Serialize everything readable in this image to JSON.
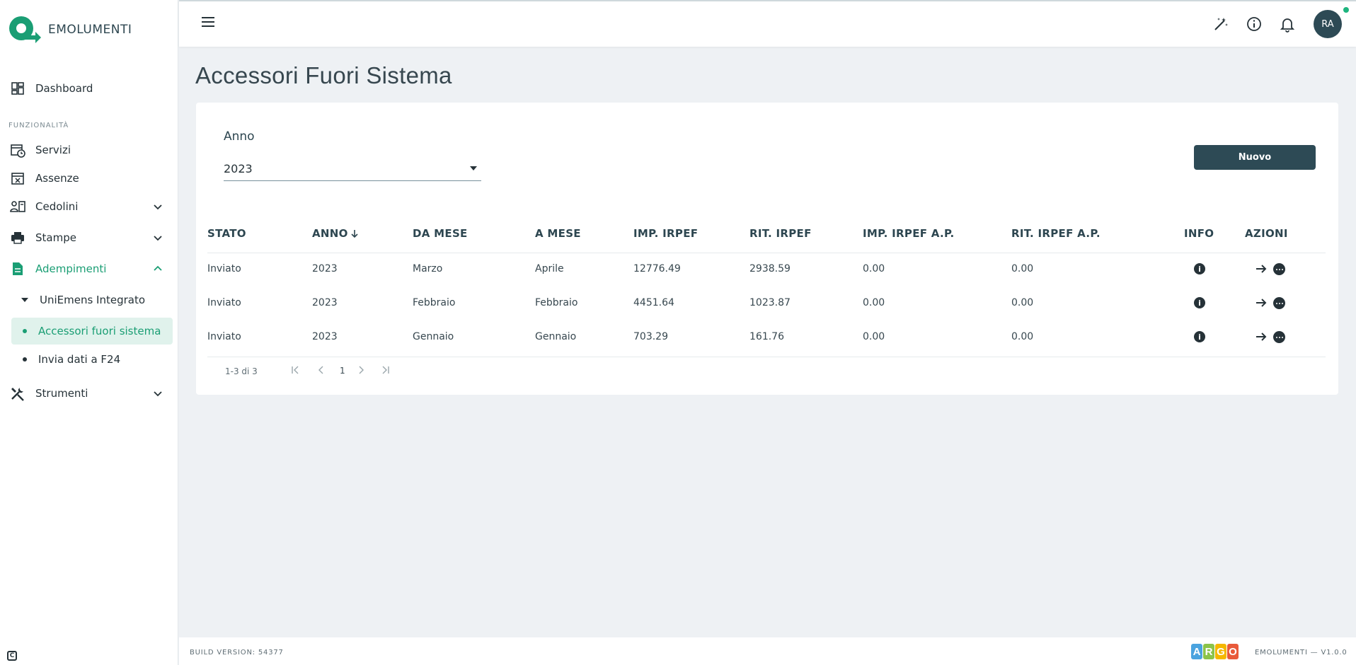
{
  "app": {
    "brand_name": "EMOLUMENTI"
  },
  "sidebar": {
    "dashboard": "Dashboard",
    "section_label": "FUNZIONALITÀ",
    "items": {
      "servizi": "Servizi",
      "assenze": "Assenze",
      "cedolini": "Cedolini",
      "stampe": "Stampe",
      "adempimenti": "Adempimenti",
      "strumenti": "Strumenti"
    },
    "sub": {
      "uniemens": "UniEmens Integrato",
      "accessori": "Accessori fuori sistema",
      "f24": "Invia dati a F24"
    }
  },
  "topbar": {
    "avatar_initials": "RA"
  },
  "page": {
    "title": "Accessori Fuori Sistema"
  },
  "filter": {
    "label": "Anno",
    "value": "2023"
  },
  "actions": {
    "new_label": "Nuovo"
  },
  "table": {
    "headers": {
      "stato": "STATO",
      "anno": "ANNO",
      "da_mese": "DA MESE",
      "a_mese": "A MESE",
      "imp_irpef": "IMP. IRPEF",
      "rit_irpef": "RIT. IRPEF",
      "imp_irpef_ap": "IMP. IRPEF A.P.",
      "rit_irpef_ap": "RIT. IRPEF A.P.",
      "info": "INFO",
      "azioni": "AZIONI"
    },
    "rows": [
      {
        "stato": "Inviato",
        "anno": "2023",
        "da_mese": "Marzo",
        "a_mese": "Aprile",
        "imp_irpef": "12776.49",
        "rit_irpef": "2938.59",
        "imp_irpef_ap": "0.00",
        "rit_irpef_ap": "0.00"
      },
      {
        "stato": "Inviato",
        "anno": "2023",
        "da_mese": "Febbraio",
        "a_mese": "Febbraio",
        "imp_irpef": "4451.64",
        "rit_irpef": "1023.87",
        "imp_irpef_ap": "0.00",
        "rit_irpef_ap": "0.00"
      },
      {
        "stato": "Inviato",
        "anno": "2023",
        "da_mese": "Gennaio",
        "a_mese": "Gennaio",
        "imp_irpef": "703.29",
        "rit_irpef": "161.76",
        "imp_irpef_ap": "0.00",
        "rit_irpef_ap": "0.00"
      }
    ]
  },
  "pagination": {
    "range": "1-3 di 3",
    "page": "1"
  },
  "footer": {
    "build": "BUILD VERSION: 54377",
    "argo_letters": [
      "A",
      "R",
      "G",
      "O"
    ],
    "argo_colors": [
      "#4aa3df",
      "#8bc34a",
      "#f5b700",
      "#e95a3a"
    ],
    "version": "EMOLUMENTI — V1.0.0"
  },
  "colors": {
    "accent": "#1a9e74",
    "primary": "#2d4a55"
  }
}
